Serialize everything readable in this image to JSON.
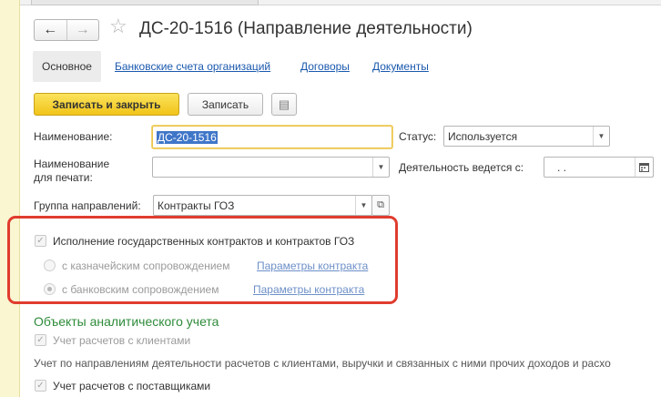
{
  "window": {
    "title": "ДС-20-1516 (Направление деятельности)"
  },
  "icons": {
    "back": "arrow-left-icon",
    "forward": "arrow-right-icon",
    "favorite": "star-icon",
    "more": "list-menu-icon",
    "dropdown": "triangle-down-icon",
    "calendar": "calendar-icon",
    "open": "open-form-icon",
    "checkbox": "checkmark-icon"
  },
  "tabs": [
    {
      "label": "Основное",
      "active": true
    },
    {
      "label": "Банковские счета организаций",
      "active": false
    },
    {
      "label": "Договоры",
      "active": false
    },
    {
      "label": "Документы",
      "active": false
    }
  ],
  "toolbar": {
    "save_close_label": "Записать и закрыть",
    "save_label": "Записать",
    "more_glyph": "▤"
  },
  "form": {
    "name_label": "Наименование:",
    "name_value": "ДС-20-1516",
    "print_name_label_line1": "Наименование",
    "print_name_label_line2": "для печати:",
    "print_name_value": "",
    "group_label": "Группа направлений:",
    "group_value": "Контракты ГОЗ",
    "status_label": "Статус:",
    "status_value": "Используется",
    "activity_date_label": "Деятельность ведется с:",
    "activity_date_value": ". ."
  },
  "gov_contracts": {
    "checkbox_label": "Исполнение государственных контрактов и контрактов ГОЗ",
    "checked": true,
    "treasury_label": "с казначейским сопровождением",
    "treasury_link": "Параметры контракта",
    "bank_label": "с банковским сопровождением",
    "bank_link": "Параметры контракта",
    "selected_option": "bank"
  },
  "analytics": {
    "section_title": "Объекты аналитического учета",
    "clients_label": "Учет расчетов с клиентами",
    "clients_checked": true,
    "clients_description": "Учет по направлениям деятельности расчетов с клиентами, выручки и связанных с ними прочих доходов и расхо",
    "suppliers_label": "Учет расчетов с поставщиками",
    "suppliers_checked": true
  },
  "colors": {
    "accent_yellow": "#f1c419",
    "link_blue": "#1b59ae",
    "section_green": "#2e8b3a",
    "highlight_red": "#e03c2f",
    "selection_blue": "#3f76c8"
  }
}
